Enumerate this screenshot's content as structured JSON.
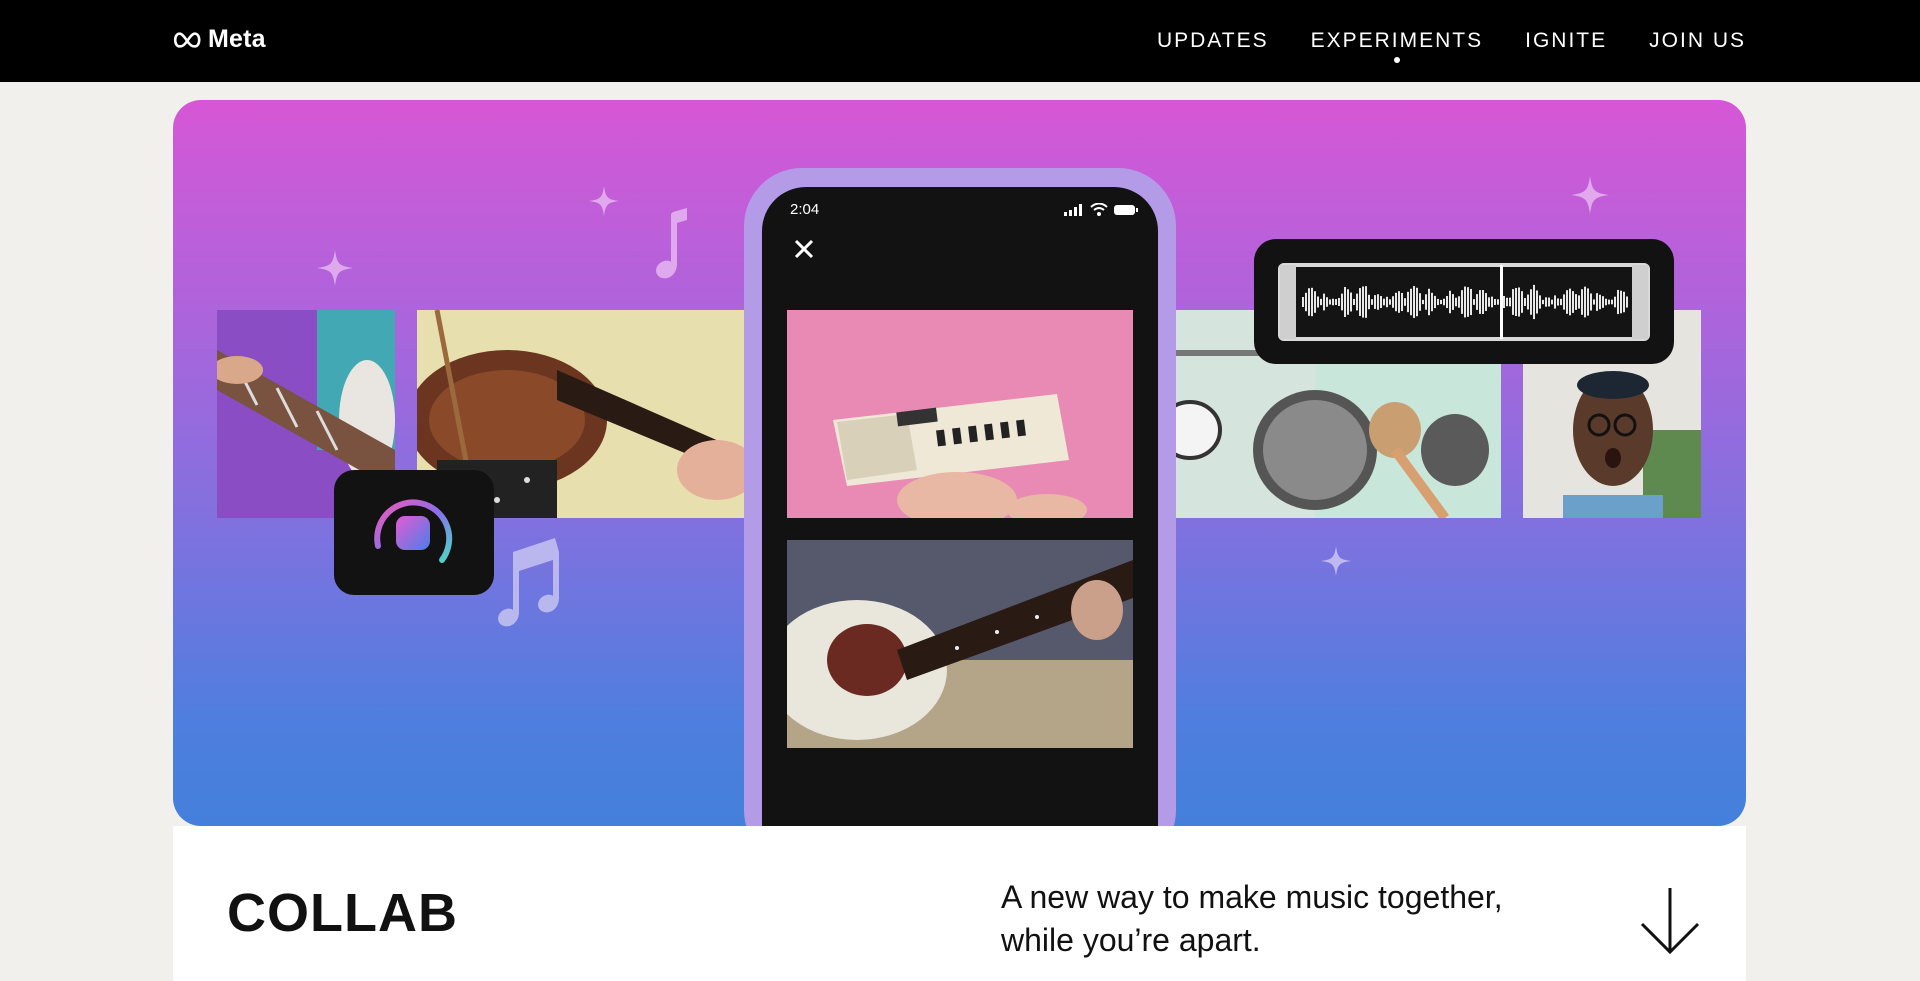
{
  "header": {
    "logo_text": "Meta",
    "nav": [
      {
        "label": "UPDATES"
      },
      {
        "label": "EXPERIMENTS",
        "active": true
      },
      {
        "label": "IGNITE"
      },
      {
        "label": "JOIN US"
      }
    ]
  },
  "hero": {
    "phone": {
      "status_time": "2:04",
      "close_icon": "close-icon"
    },
    "icons": [
      "sparkle-icon",
      "music-note-icon",
      "record-button-icon",
      "audio-waveform-icon"
    ]
  },
  "content": {
    "title": "COLLAB",
    "tagline_line1": "A new way to make music together,",
    "tagline_line2": "while you’re apart.",
    "scroll_icon": "arrow-down-icon"
  },
  "colors": {
    "nav_bg": "#000000",
    "page_bg": "#f1f0ed",
    "gradient_top": "#d657d6",
    "gradient_bottom": "#4380db",
    "phone_frame": "#b49be8"
  }
}
